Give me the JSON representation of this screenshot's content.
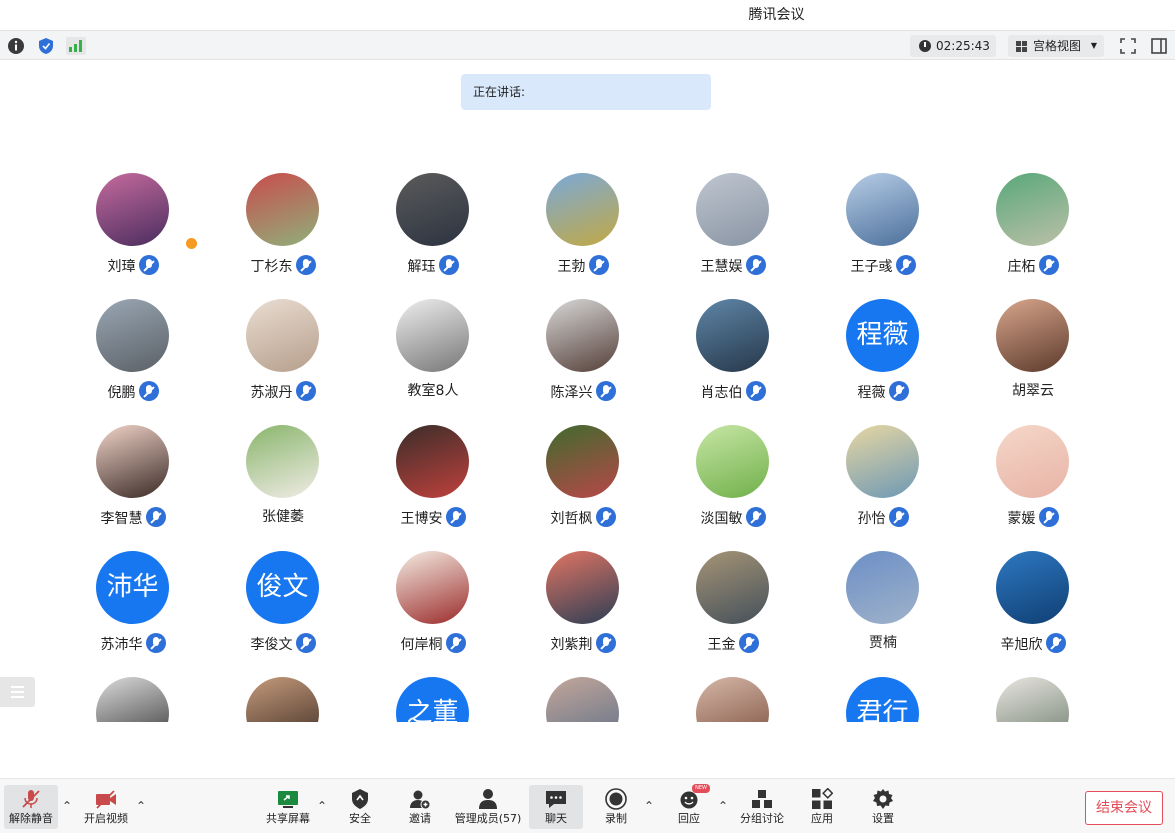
{
  "app": {
    "title": "腾讯会议"
  },
  "topbar": {
    "timer": "02:25:43",
    "view_mode": "宫格视图"
  },
  "speaking": {
    "label": "正在讲话:"
  },
  "participants": [
    {
      "name": "刘璋",
      "avatar": "photo",
      "mic_muted": true,
      "host": true
    },
    {
      "name": "丁杉东",
      "avatar": "photo",
      "mic_muted": true
    },
    {
      "name": "解珏",
      "avatar": "photo",
      "mic_muted": true
    },
    {
      "name": "王勃",
      "avatar": "photo",
      "mic_muted": true
    },
    {
      "name": "王慧娱",
      "avatar": "photo",
      "mic_muted": true
    },
    {
      "name": "王子彧",
      "avatar": "photo",
      "mic_muted": true
    },
    {
      "name": "庄柘",
      "avatar": "photo",
      "mic_muted": true
    },
    {
      "name": "倪鹏",
      "avatar": "photo",
      "mic_muted": true
    },
    {
      "name": "苏淑丹",
      "avatar": "photo",
      "mic_muted": true
    },
    {
      "name": "教室8人",
      "avatar": "photo",
      "mic_muted": false
    },
    {
      "name": "陈泽兴",
      "avatar": "photo",
      "mic_muted": true
    },
    {
      "name": "肖志伯",
      "avatar": "photo",
      "mic_muted": true
    },
    {
      "name": "程薇",
      "avatar": "text",
      "avatar_text": "程薇",
      "mic_muted": true
    },
    {
      "name": "胡翠云",
      "avatar": "photo",
      "mic_muted": false
    },
    {
      "name": "李智慧",
      "avatar": "photo",
      "mic_muted": true
    },
    {
      "name": "张健萎",
      "avatar": "photo",
      "mic_muted": false
    },
    {
      "name": "王博安",
      "avatar": "photo",
      "mic_muted": true
    },
    {
      "name": "刘哲枫",
      "avatar": "photo",
      "mic_muted": true
    },
    {
      "name": "淡国敏",
      "avatar": "photo",
      "mic_muted": true
    },
    {
      "name": "孙怡",
      "avatar": "photo",
      "mic_muted": true
    },
    {
      "name": "蒙媛",
      "avatar": "photo",
      "mic_muted": true
    },
    {
      "name": "苏沛华",
      "avatar": "text",
      "avatar_text": "沛华",
      "mic_muted": true
    },
    {
      "name": "李俊文",
      "avatar": "text",
      "avatar_text": "俊文",
      "mic_muted": true
    },
    {
      "name": "何岸桐",
      "avatar": "photo",
      "mic_muted": true
    },
    {
      "name": "刘紫荆",
      "avatar": "photo",
      "mic_muted": true
    },
    {
      "name": "王金",
      "avatar": "photo",
      "mic_muted": true
    },
    {
      "name": "贾楠",
      "avatar": "photo",
      "mic_muted": false
    },
    {
      "name": "辛旭欣",
      "avatar": "photo",
      "mic_muted": true
    },
    {
      "name": "",
      "avatar": "photo"
    },
    {
      "name": "",
      "avatar": "photo"
    },
    {
      "name": "",
      "avatar": "text",
      "avatar_text": "之董"
    },
    {
      "name": "",
      "avatar": "photo"
    },
    {
      "name": "",
      "avatar": "photo"
    },
    {
      "name": "",
      "avatar": "text",
      "avatar_text": "君行"
    },
    {
      "name": "",
      "avatar": "photo"
    }
  ],
  "bottombar": {
    "unmute": "解除静音",
    "video": "开启视频",
    "share": "共享屏幕",
    "security": "安全",
    "invite": "邀请",
    "members": "管理成员(57)",
    "chat": "聊天",
    "record": "录制",
    "reaction": "回应",
    "new_badge": "NEW",
    "breakout": "分组讨论",
    "apps": "应用",
    "settings": "设置",
    "end": "结束会议"
  },
  "colors": {
    "accent": "#1677f0",
    "end": "#e34d59",
    "speaking_bg": "#dae8fb"
  }
}
